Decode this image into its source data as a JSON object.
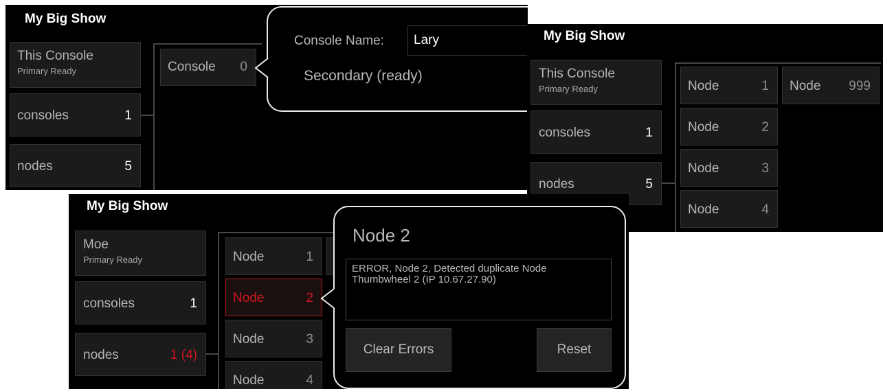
{
  "panel_a": {
    "title": "My Big Show",
    "sidebar": [
      {
        "label": "This Console",
        "sub": "Primary Ready"
      },
      {
        "label": "consoles",
        "count": "1"
      },
      {
        "label": "nodes",
        "count": "5"
      }
    ],
    "console_tile": {
      "label": "Console",
      "num": "0"
    },
    "popup": {
      "name_label": "Console Name:",
      "name_value": "Lary",
      "status": "Secondary (ready)"
    }
  },
  "panel_b": {
    "title": "My Big Show",
    "sidebar": [
      {
        "label": "This Console",
        "sub": "Primary Ready"
      },
      {
        "label": "consoles",
        "count": "1"
      },
      {
        "label": "nodes",
        "count": "5"
      }
    ],
    "nodes": [
      {
        "label": "Node",
        "num": "1"
      },
      {
        "label": "Node",
        "num": "2"
      },
      {
        "label": "Node",
        "num": "3"
      },
      {
        "label": "Node",
        "num": "4"
      },
      {
        "label": "Node",
        "num": "999"
      }
    ]
  },
  "panel_c": {
    "title": "My Big Show",
    "sidebar": [
      {
        "label": "Moe",
        "sub": "Primary Ready"
      },
      {
        "label": "consoles",
        "count": "1"
      },
      {
        "label": "nodes",
        "count": "1 (4)"
      }
    ],
    "nodes": [
      {
        "label": "Node",
        "num": "1"
      },
      {
        "label": "Node",
        "num": "2"
      },
      {
        "label": "Node",
        "num": "3"
      },
      {
        "label": "Node",
        "num": "4"
      }
    ],
    "popup": {
      "heading": "Node 2",
      "message": "ERROR, Node 2, Detected duplicate Node Thumbwheel 2 (IP 10.67.27.90)",
      "clear_button": "Clear Errors",
      "reset_button": "Reset"
    }
  },
  "colors": {
    "background": "#000000",
    "tile": "#1b1b1b",
    "error": "#d0161d",
    "popup_border": "#ececec"
  }
}
